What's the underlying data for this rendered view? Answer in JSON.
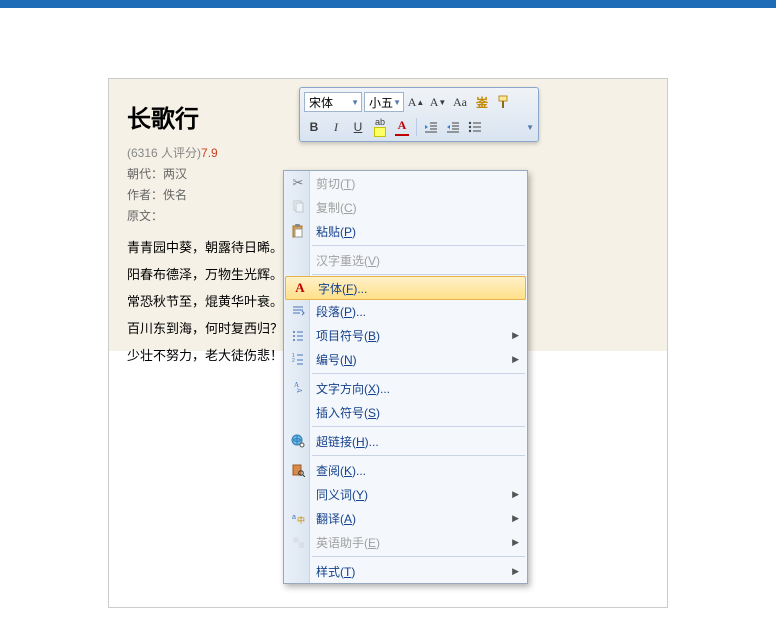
{
  "poem": {
    "title": "长歌行",
    "rating_text": "(6316 人评分)",
    "score": "7.9",
    "dynasty_label": "朝代：",
    "dynasty": "两汉",
    "author_label": "作者：",
    "author": "佚名",
    "original_label": "原文：",
    "lines": [
      "青青园中葵，朝露待日晞。",
      "阳春布德泽，万物生光辉。",
      "常恐秋节至，焜黄华叶衰。",
      "百川东到海，何时复西归？",
      "少壮不努力，老大徒伤悲！"
    ]
  },
  "toolbar": {
    "font_name": "宋体",
    "font_size": "小五"
  },
  "menu": {
    "cut": "剪切(T)",
    "copy": "复制(C)",
    "paste": "粘贴(P)",
    "cjk_reselect": "汉字重选(V)",
    "font": "字体(F)...",
    "paragraph": "段落(P)...",
    "bullets": "项目符号(B)",
    "numbering": "编号(N)",
    "text_direction": "文字方向(X)...",
    "insert_symbol": "插入符号(S)",
    "hyperlink": "超链接(H)...",
    "lookup": "查阅(K)...",
    "synonyms": "同义词(Y)",
    "translate": "翻译(A)",
    "english_assistant": "英语助手(E)",
    "styles": "样式(T)"
  }
}
